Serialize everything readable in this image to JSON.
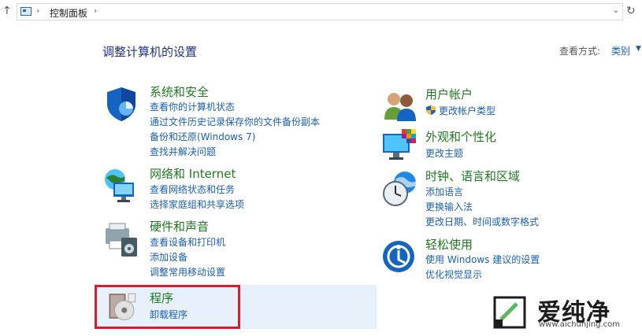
{
  "address": {
    "breadcrumb": "控制面板",
    "icons": {
      "back": "up-arrow-icon",
      "home": "control-panel-icon",
      "refresh": "refresh-icon"
    }
  },
  "main": {
    "title": "调整计算机的设置",
    "view_label": "查看方式:",
    "view_value": "类别"
  },
  "categories": {
    "security": {
      "title": "系统和安全",
      "links": [
        "查看你的计算机状态",
        "通过文件历史记录保存你的文件备份副本",
        "备份和还原(Windows 7)",
        "查找并解决问题"
      ]
    },
    "network": {
      "title": "网络和 Internet",
      "links": [
        "查看网络状态和任务",
        "选择家庭组和共享选项"
      ]
    },
    "hardware": {
      "title": "硬件和声音",
      "links": [
        "查看设备和打印机",
        "添加设备",
        "调整常用移动设置"
      ]
    },
    "programs": {
      "title": "程序",
      "links": [
        "卸载程序"
      ]
    },
    "users": {
      "title": "用户帐户",
      "links": [
        "更改帐户类型"
      ]
    },
    "appearance": {
      "title": "外观和个性化",
      "links": [
        "更改主题"
      ]
    },
    "clock": {
      "title": "时钟、语言和区域",
      "links": [
        "添加语言",
        "更换输入法",
        "更改日期、时间或数字格式"
      ]
    },
    "ease": {
      "title": "轻松使用",
      "links": [
        "使用 Windows 建议的设置",
        "优化视觉显示"
      ]
    }
  },
  "watermark": {
    "name": "爱纯净",
    "url": "www.aichunjing.com"
  },
  "colors": {
    "title_green": "#1f7a1f",
    "link_blue": "#1a5fb4",
    "highlight": "#e6f1fb",
    "red_box": "#d41f2a"
  }
}
